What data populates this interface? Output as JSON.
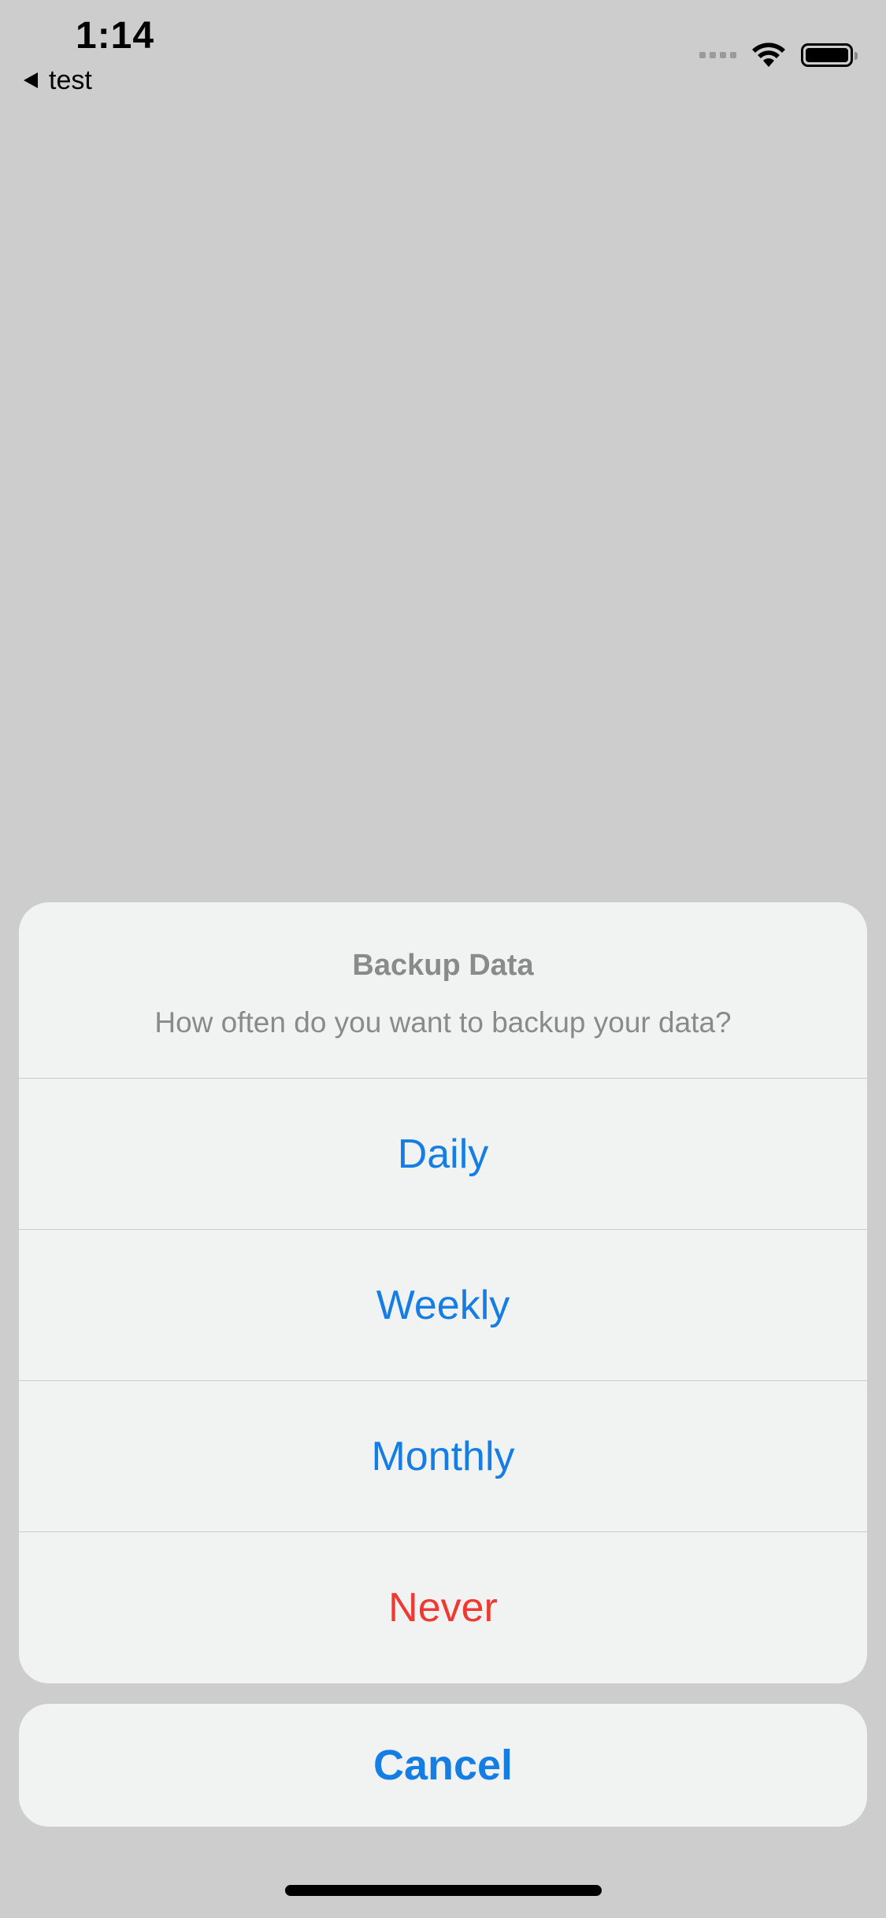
{
  "status_bar": {
    "time": "1:14",
    "back_label": "test",
    "icons": {
      "signal": "cellular-signal-icon",
      "wifi": "wifi-icon",
      "battery": "battery-icon"
    }
  },
  "action_sheet": {
    "title": "Backup Data",
    "message": "How often do you want to backup your data?",
    "options": [
      {
        "label": "Daily",
        "style": "default"
      },
      {
        "label": "Weekly",
        "style": "default"
      },
      {
        "label": "Monthly",
        "style": "default"
      },
      {
        "label": "Never",
        "style": "destructive"
      }
    ],
    "cancel_label": "Cancel"
  },
  "colors": {
    "background": "#cdcdcd",
    "sheet": "#f1f2f2",
    "accent": "#147ee5",
    "destructive": "#ef3a32",
    "secondary_text": "#8a8a8a"
  }
}
